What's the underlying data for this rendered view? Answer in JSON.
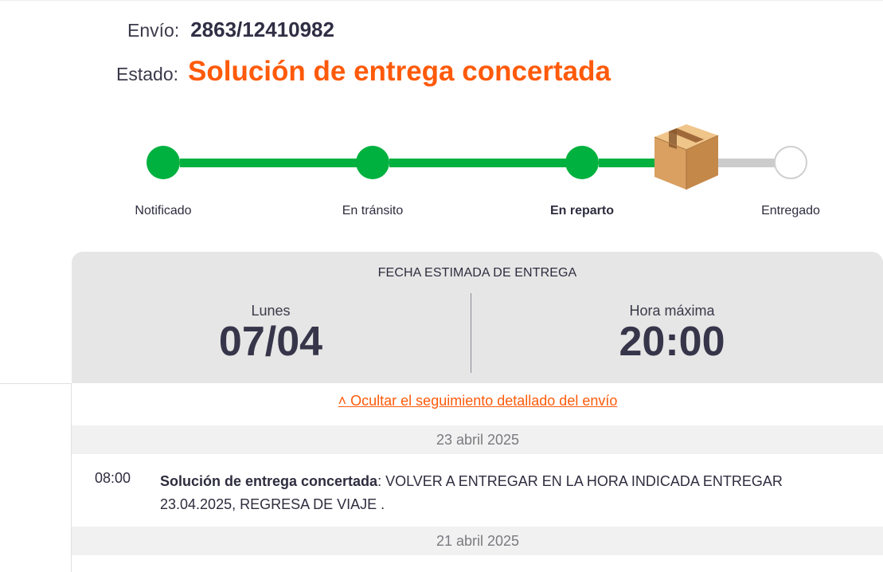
{
  "shipment": {
    "label": "Envío:",
    "number": "2863/12410982",
    "status_label": "Estado:",
    "status_value": "Solución de entrega concertada"
  },
  "tracker": {
    "steps": [
      {
        "label": "Notificado",
        "state": "done"
      },
      {
        "label": "En tránsito",
        "state": "done"
      },
      {
        "label": "En reparto",
        "state": "current"
      },
      {
        "label": "Entregado",
        "state": "pending"
      }
    ],
    "colors": {
      "done": "#00b13f",
      "pending": "#cccccc"
    },
    "current_icon": "package-box-icon"
  },
  "estimate": {
    "title": "FECHA ESTIMADA DE ENTREGA",
    "day_label": "Lunes",
    "date": "07/04",
    "time_label": "Hora máxima",
    "time": "20:00"
  },
  "details": {
    "toggle_link": "˄ Ocultar el seguimiento detallado del envío",
    "groups": [
      {
        "date": "23 abril 2025",
        "events": [
          {
            "time": "08:00",
            "title": "Solución de entrega concertada",
            "description": ": VOLVER A ENTREGAR EN LA HORA INDICADA ENTREGAR 23.04.2025, REGRESA DE VIAJE ."
          }
        ]
      },
      {
        "date": "21 abril 2025",
        "events": []
      }
    ]
  },
  "colors": {
    "accent": "#ff5a0a",
    "success": "#00b13f",
    "text": "#2e2d3f"
  }
}
